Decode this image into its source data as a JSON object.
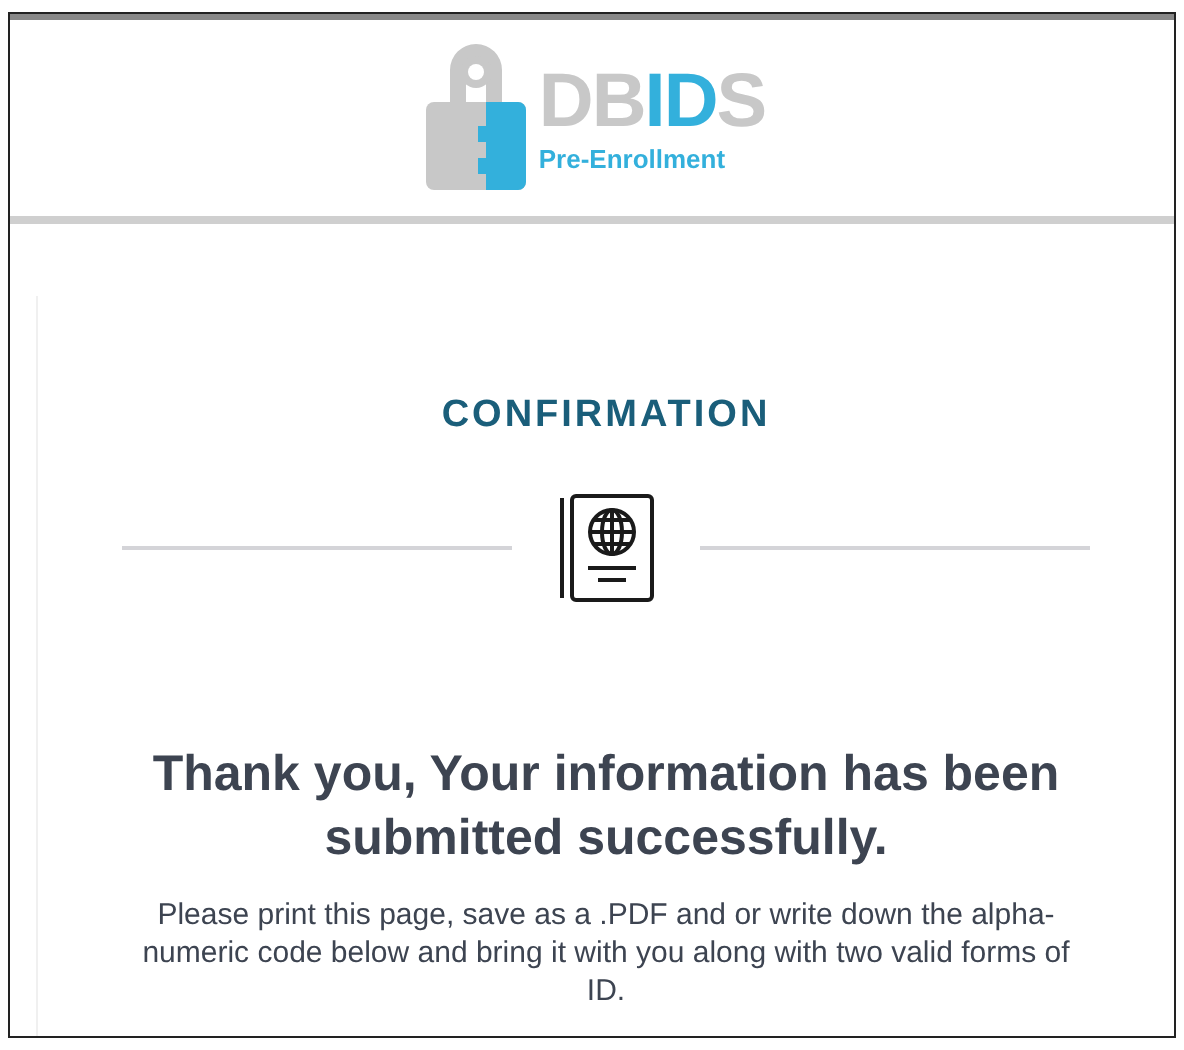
{
  "logo": {
    "wordmark": [
      {
        "text": "DB",
        "highlight": false
      },
      {
        "text": "ID",
        "highlight": true
      },
      {
        "text": "S",
        "highlight": false
      }
    ],
    "subtitle": "Pre-Enrollment"
  },
  "confirmation": {
    "title": "CONFIRMATION",
    "heading": "Thank you, Your information has been submitted successfully.",
    "message": "Please print this page, save as a .PDF and or write down the alpha-numeric code below and bring it with you along with two valid forms of ID."
  }
}
